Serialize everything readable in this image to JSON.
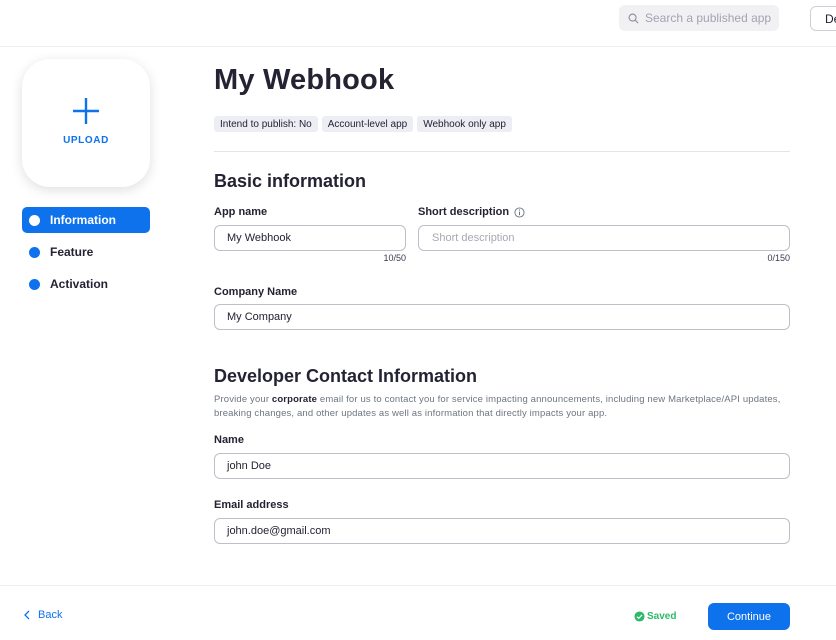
{
  "header": {
    "search_placeholder": "Search a published app",
    "top_button_label": "De"
  },
  "sidebar": {
    "upload_label": "UPLOAD",
    "items": [
      {
        "label": "Information",
        "active": true
      },
      {
        "label": "Feature",
        "active": false
      },
      {
        "label": "Activation",
        "active": false
      }
    ]
  },
  "main": {
    "title": "My Webhook",
    "tags": [
      "Intend to publish: No",
      "Account-level app",
      "Webhook only app"
    ],
    "basic_info": {
      "heading": "Basic information",
      "app_name_label": "App name",
      "app_name_value": "My Webhook",
      "app_name_counter": "10/50",
      "short_desc_label": "Short description",
      "short_desc_placeholder": "Short description",
      "short_desc_counter": "0/150",
      "company_name_label": "Company Name",
      "company_name_value": "My Company"
    },
    "developer_contact": {
      "heading": "Developer Contact Information",
      "desc_prefix": "Provide your ",
      "desc_bold": "corporate",
      "desc_suffix": " email for us to contact you for service impacting announcements, including new Marketplace/API updates, breaking changes, and other updates as well as information that directly impacts your app.",
      "name_label": "Name",
      "name_value": "john Doe",
      "email_label": "Email address",
      "email_value": "john.doe@gmail.com"
    }
  },
  "footer": {
    "back_label": "Back",
    "saved_label": "Saved",
    "continue_label": "Continue"
  },
  "colors": {
    "accent": "#0e72ed",
    "saved_green": "#2dba68",
    "tag_bg": "#ededf4"
  },
  "icons": [
    "search-icon",
    "plus-icon",
    "info-icon",
    "chevron-left-icon",
    "check-circle-icon"
  ]
}
